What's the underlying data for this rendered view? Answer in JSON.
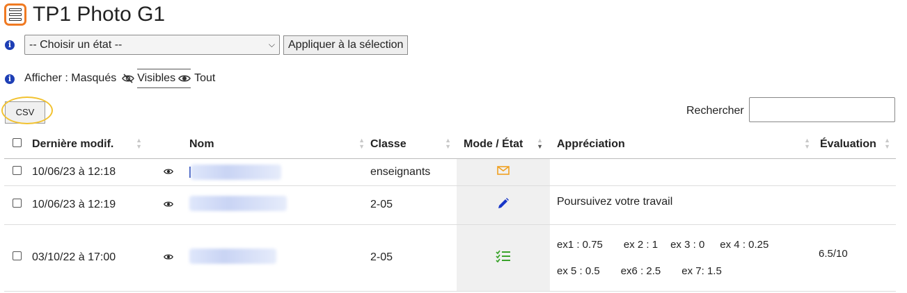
{
  "title": "TP1 Photo G1",
  "toolbar": {
    "select_value": "-- Choisir un état --",
    "apply_label": "Appliquer à la sélection"
  },
  "display": {
    "prefix": "Afficher :",
    "hidden": "Masqués",
    "visible": "Visibles",
    "all": "Tout"
  },
  "csv_label": "CSV",
  "search_label": "Rechercher",
  "search_value": "",
  "columns": {
    "modified": "Dernière modif.",
    "name": "Nom",
    "class": "Classe",
    "mode": "Mode / État",
    "appreciation": "Appréciation",
    "evaluation": "Évaluation"
  },
  "rows": [
    {
      "modified": "10/06/23 à 12:18",
      "class": "enseignants",
      "mode_icon": "envelope-icon",
      "appreciation": "",
      "evaluation": ""
    },
    {
      "modified": "10/06/23 à 12:19",
      "class": "2-05",
      "mode_icon": "pencil-icon",
      "appreciation": "Poursuivez votre travail",
      "evaluation": ""
    },
    {
      "modified": "03/10/22 à 17:00",
      "class": "2-05",
      "mode_icon": "checklist-icon",
      "appreciation": "",
      "grades": [
        "ex1 : 0.75",
        "ex 2 : 1",
        "ex 3 :  0",
        "ex 4 : 0.25",
        "ex 5 :  0.5",
        "ex6 :  2.5",
        "ex 7:   1.5"
      ],
      "evaluation": "6.5/10"
    }
  ],
  "colors": {
    "accent_orange": "#f07a22",
    "highlight_ring": "#f2c230",
    "info_blue": "#1e3fb5",
    "pencil_blue": "#1836c8",
    "checklist_green": "#3aa32b"
  }
}
